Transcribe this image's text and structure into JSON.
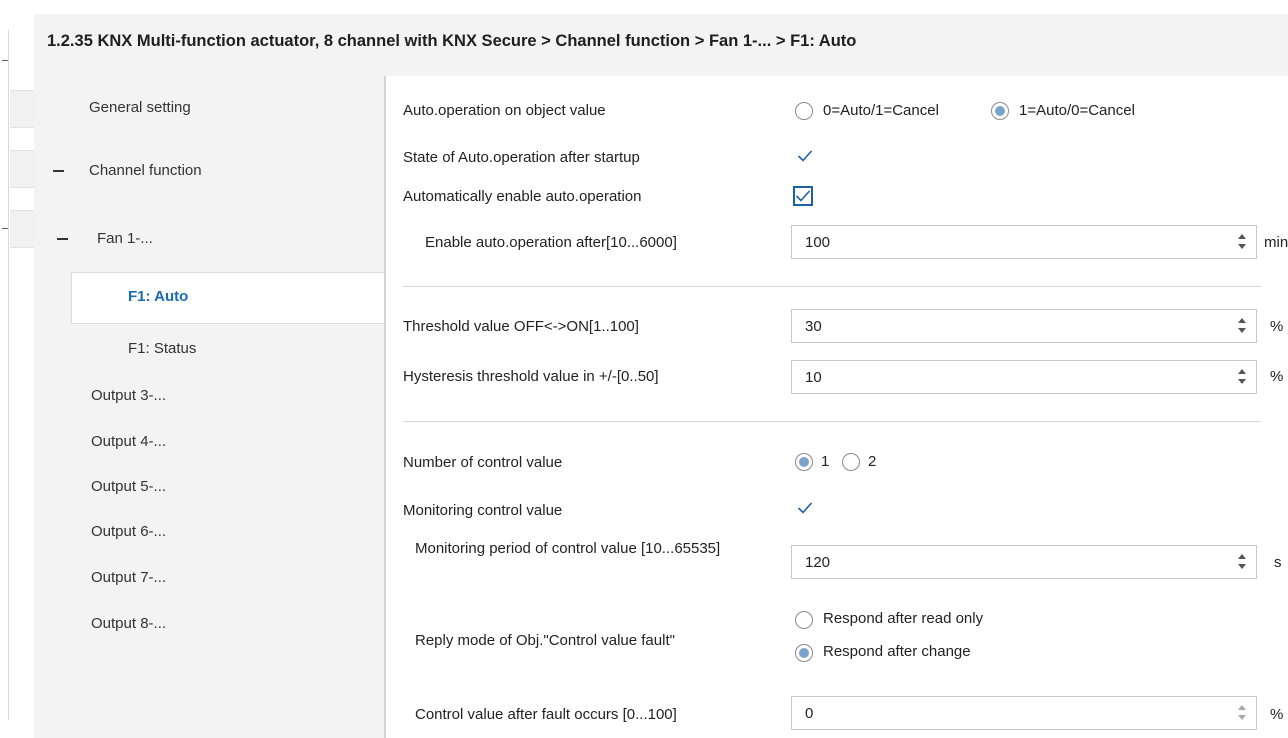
{
  "title": "1.2.35 KNX Multi-function actuator, 8 channel with KNX Secure > Channel function > Fan 1-... > F1: Auto",
  "sidebar": {
    "items": [
      {
        "label": "General setting"
      },
      {
        "label": "Channel function",
        "expander": "−"
      },
      {
        "label": "Fan 1-...",
        "expander": "−"
      },
      {
        "label": "F1: Auto",
        "selected": true
      },
      {
        "label": "F1: Status"
      },
      {
        "label": "Output 3-..."
      },
      {
        "label": "Output 4-..."
      },
      {
        "label": "Output 5-..."
      },
      {
        "label": "Output 6-..."
      },
      {
        "label": "Output 7-..."
      },
      {
        "label": "Output 8-..."
      }
    ]
  },
  "params": {
    "auto_op": {
      "label": "Auto.operation on object value",
      "options": [
        "0=Auto/1=Cancel",
        "1=Auto/0=Cancel"
      ],
      "selected": "1=Auto/0=Cancel"
    },
    "state_after_startup": {
      "label": "State of Auto.operation after startup",
      "checked": true
    },
    "auto_enable": {
      "label": "Automatically enable auto.operation",
      "checked": true
    },
    "enable_after": {
      "label": "Enable auto.operation after[10...6000]",
      "value": "100",
      "unit": "min"
    },
    "threshold": {
      "label": "Threshold value OFF<->ON[1..100]",
      "value": "30",
      "unit": "%"
    },
    "hysteresis": {
      "label": "Hysteresis threshold value in +/-[0..50]",
      "value": "10",
      "unit": "%"
    },
    "num_control": {
      "label": "Number of control value",
      "options": [
        "1",
        "2"
      ],
      "selected": "1"
    },
    "monitoring": {
      "label": "Monitoring control value",
      "checked": true
    },
    "monitoring_period": {
      "label": "Monitoring period of control value [10...65535]",
      "value": "120",
      "unit": "s"
    },
    "reply_mode": {
      "label": "Reply mode of Obj.\"Control value fault\"",
      "options": [
        "Respond after read only",
        "Respond after change"
      ],
      "selected": "Respond after change"
    },
    "fault_value": {
      "label": "Control value after fault occurs [0...100]",
      "value": "0",
      "unit": "%"
    }
  },
  "colors": {
    "accent": "#1a6bb5",
    "radio_fill": "#7aa3cc",
    "check": "#1f5fa8"
  }
}
